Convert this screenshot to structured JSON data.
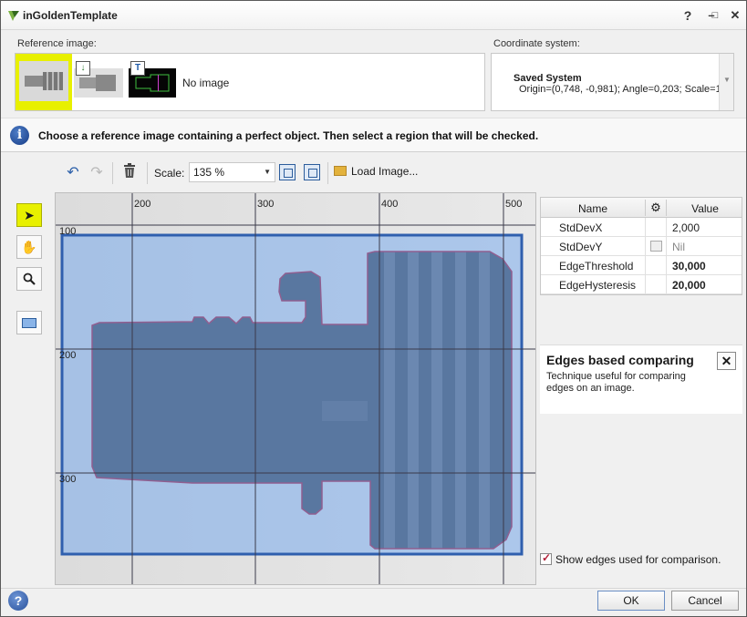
{
  "window": {
    "title": "inGoldenTemplate",
    "controls": {
      "help": "?",
      "minimize": "–",
      "maximize": "□",
      "close": "✕"
    }
  },
  "reference": {
    "label": "Reference image:",
    "no_image": "No image",
    "thumbnails": [
      {
        "selected": true,
        "badge": ""
      },
      {
        "selected": false,
        "badge": "↓"
      },
      {
        "selected": false,
        "badge": "T"
      }
    ]
  },
  "coordinate": {
    "label": "Coordinate system:",
    "name": "Saved System",
    "detail": "Origin=(0,748, -0,981); Angle=0,203; Scale=1"
  },
  "info": {
    "icon": "info-icon",
    "text": "Choose a reference image containing a perfect object. Then select a region that will be checked."
  },
  "toolbar": {
    "scale_label": "Scale:",
    "scale_value": "135 %",
    "load_label": "Load Image..."
  },
  "canvas": {
    "ruler_x": [
      "200",
      "300",
      "400",
      "500"
    ],
    "ruler_y": [
      "100",
      "200",
      "300"
    ]
  },
  "grid": {
    "col_name": "Name",
    "col_value": "Value",
    "rows": [
      {
        "name": "StdDevX",
        "value": "2,000",
        "has_check": false,
        "bold": false,
        "dim": false
      },
      {
        "name": "StdDevY",
        "value": "Nil",
        "has_check": true,
        "bold": false,
        "dim": true
      },
      {
        "name": "EdgeThreshold",
        "value": "30,000",
        "has_check": false,
        "bold": true,
        "dim": false
      },
      {
        "name": "EdgeHysteresis",
        "value": "20,000",
        "has_check": false,
        "bold": true,
        "dim": false
      }
    ]
  },
  "description": {
    "title": "Edges based comparing",
    "text": "Technique useful for comparing edges on an image.",
    "close": "✕"
  },
  "show_edges": {
    "checked": true,
    "label": "Show edges used for comparison."
  },
  "footer": {
    "help": "?",
    "ok": "OK",
    "cancel": "Cancel"
  }
}
